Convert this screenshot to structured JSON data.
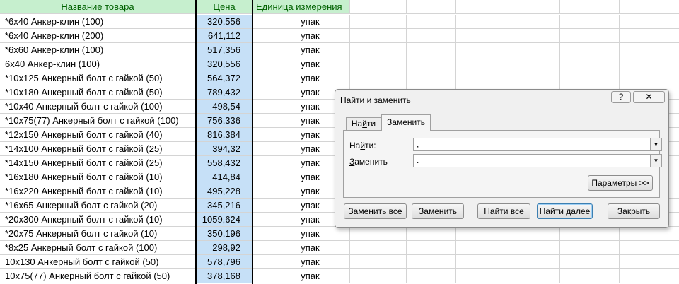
{
  "sheet": {
    "headers": [
      "Название товара",
      "Цена",
      "Единица измерения"
    ],
    "rows": [
      {
        "name": "*6х40 Анкер-клин (100)",
        "price": "320,556",
        "unit": "упак"
      },
      {
        "name": "*6х40 Анкер-клин (200)",
        "price": "641,112",
        "unit": "упак"
      },
      {
        "name": "*6х60 Анкер-клин (100)",
        "price": "517,356",
        "unit": "упак"
      },
      {
        "name": "6х40 Анкер-клин (100)",
        "price": "320,556",
        "unit": "упак"
      },
      {
        "name": "*10х125 Анкерный болт с гайкой (50)",
        "price": "564,372",
        "unit": "упак"
      },
      {
        "name": "*10х180 Анкерный болт с гайкой (50)",
        "price": "789,432",
        "unit": "упак"
      },
      {
        "name": "*10х40 Анкерный болт с гайкой (100)",
        "price": "498,54",
        "unit": "упак"
      },
      {
        "name": "*10х75(77) Анкерный болт с гайкой (100)",
        "price": "756,336",
        "unit": "упак"
      },
      {
        "name": "*12х150 Анкерный болт с гайкой (40)",
        "price": "816,384",
        "unit": "упак"
      },
      {
        "name": "*14х100 Анкерный болт с гайкой (25)",
        "price": "394,32",
        "unit": "упак"
      },
      {
        "name": "*14х150 Анкерный болт с гайкой (25)",
        "price": "558,432",
        "unit": "упак"
      },
      {
        "name": "*16х180 Анкерный болт с гайкой (10)",
        "price": "414,84",
        "unit": "упак"
      },
      {
        "name": "*16х220 Анкерный болт с гайкой (10)",
        "price": "495,228",
        "unit": "упак"
      },
      {
        "name": "*16х65 Анкерный болт с гайкой (20)",
        "price": "345,216",
        "unit": "упак"
      },
      {
        "name": "*20х300 Анкерный болт с гайкой (10)",
        "price": "1059,624",
        "unit": "упак"
      },
      {
        "name": "*20х75 Анкерный болт с гайкой (10)",
        "price": "350,196",
        "unit": "упак"
      },
      {
        "name": "*8х25 Анкерный болт с гайкой (100)",
        "price": "298,92",
        "unit": "упак"
      },
      {
        "name": "10х130 Анкерный болт с гайкой (50)",
        "price": "578,796",
        "unit": "упак"
      },
      {
        "name": "10х75(77) Анкерный болт с гайкой (50)",
        "price": "378,168",
        "unit": "упак"
      }
    ]
  },
  "dialog": {
    "title": "Найти и заменить",
    "help_glyph": "?",
    "close_glyph": "✕",
    "tab_find_pre": "На",
    "tab_find_acc": "й",
    "tab_find_post": "ти",
    "tab_replace_pre": "Замени",
    "tab_replace_acc": "т",
    "tab_replace_post": "ь",
    "find_pre": "На",
    "find_acc": "й",
    "find_post": "ти:",
    "find_value": ",",
    "replace_pre": "",
    "replace_acc": "З",
    "replace_post": "аменить",
    "replace_value": ".",
    "params_pre": "",
    "params_acc": "П",
    "params_post": "араметры >>",
    "replace_all_pre": "Заменить ",
    "replace_all_acc": "в",
    "replace_all_post": "се",
    "find_all_pre": "Найти ",
    "find_all_acc": "в",
    "find_all_post": "се",
    "find_next_pre": "Найти ",
    "find_next_acc": "д",
    "find_next_post": "алее",
    "close_label": "Закрыть"
  }
}
